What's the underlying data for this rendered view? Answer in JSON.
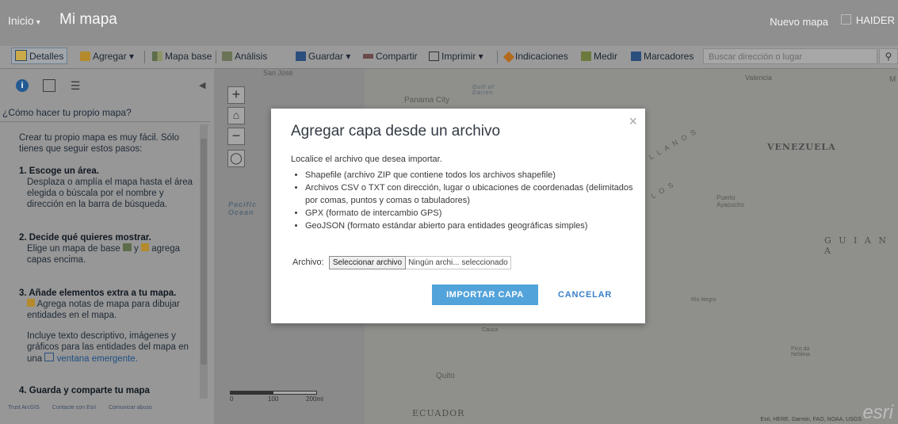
{
  "header": {
    "home_label": "Inicio",
    "home_caret": "▾",
    "map_title": "Mi mapa",
    "new_map_label": "Nuevo mapa",
    "user_label": "HAIDER"
  },
  "toolbar": {
    "details": "Detalles",
    "add": "Agregar",
    "basemap": "Mapa base",
    "analysis": "Análisis",
    "save": "Guardar",
    "share": "Compartir",
    "print": "Imprimir",
    "directions": "Indicaciones",
    "measure": "Medir",
    "bookmarks": "Marcadores",
    "search_placeholder": "Buscar dirección o lugar",
    "caret": "▾"
  },
  "panel": {
    "how_to": "¿Cómo hacer tu propio mapa?",
    "intro": "Crear tu propio mapa es muy fácil. Sólo tienes que seguir estos pasos:",
    "step1_title": "1. Escoge un área.",
    "step1_text": "Desplaza o amplía el mapa hasta el área elegida o búscala por el nombre y dirección en la barra de búsqueda.",
    "step2_title": "2. Decide qué quieres mostrar.",
    "step2_text_a": "Elige un mapa de base",
    "step2_text_b": "y",
    "step2_text_c": "agrega capas encima.",
    "step3_title": "3. Añade elementos extra a tu mapa.",
    "step3_text": "Agrega notas de mapa para dibujar entidades en el mapa.",
    "step3_text2_a": "Incluye texto descriptivo, imágenes y gráficos para las entidades del mapa en una",
    "step3_text2_link": "ventana emergente.",
    "step4_title": "4. Guarda y comparte tu mapa",
    "footer": [
      "Trust ArcGIS",
      "Contacte con Esri",
      "Comunicar abuso"
    ]
  },
  "map": {
    "zoom_in": "+",
    "home": "⌂",
    "zoom_out": "−",
    "locate": "◯",
    "labels": {
      "san_jose": "San José",
      "panama_city": "Panama City",
      "gulf": "Gulf of Darien",
      "pacific": "Pacific Ocean",
      "valencia": "Valencia",
      "venezuela": "VENEZUELA",
      "llanos": "L L A N O S",
      "puerto": "Puerto Ayacucho",
      "guiana": "G U I A N A",
      "quito": "Quito",
      "ecuador": "ECUADOR",
      "cauca": "Cauca",
      "los": "L O S",
      "rio_negro": "Rio Negro",
      "pico": "Pico da Neblina",
      "m": "M"
    },
    "scale_labels": [
      "0",
      "100",
      "200mi"
    ],
    "attribution": "Esri, HERE, Garmin, FAO, NOAA, USGS",
    "logo": "esri"
  },
  "dialog": {
    "title": "Agregar capa desde un archivo",
    "close": "×",
    "intro": "Localice el archivo que desea importar.",
    "formats": [
      "Shapefile (archivo ZIP que contiene todos los archivos shapefile)",
      "Archivos CSV o TXT con dirección, lugar o ubicaciones de coordenadas (delimitados por comas, puntos y comas o tabuladores)",
      "GPX (formato de intercambio GPS)",
      "GeoJSON (formato estándar abierto para entidades geográficas simples)"
    ],
    "file_label": "Archivo:",
    "file_button": "Seleccionar archivo",
    "file_status": "Ningún archi... seleccionado",
    "import_button": "IMPORTAR CAPA",
    "cancel_button": "CANCELAR"
  },
  "colors": {
    "accent": "#53a3db",
    "link": "#3a80c7",
    "info_tab": "#235a93"
  }
}
